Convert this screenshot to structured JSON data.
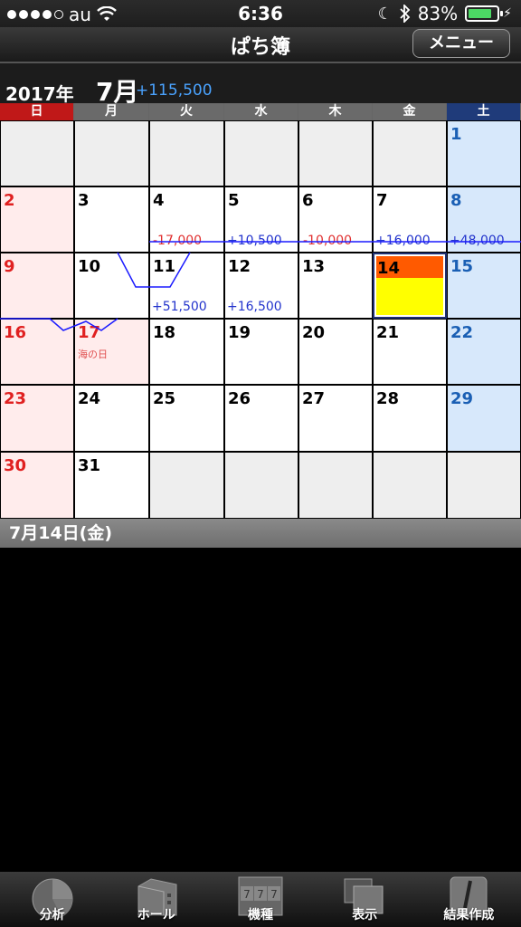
{
  "status_bar": {
    "carrier": "au",
    "time": "6:36",
    "battery": "83%",
    "battery_level": 0.83
  },
  "nav": {
    "title": "ぱち簿",
    "menu_label": "メニュー"
  },
  "header": {
    "year": "2017年",
    "month": "7月",
    "month_total": "+115,500"
  },
  "weekdays": [
    "日",
    "月",
    "火",
    "水",
    "木",
    "金",
    "土"
  ],
  "days": {
    "d1": "1",
    "d2": "2",
    "d3": "3",
    "d4": "4",
    "d5": "5",
    "d6": "6",
    "d7": "7",
    "d8": "8",
    "d9": "9",
    "d10": "10",
    "d11": "11",
    "d12": "12",
    "d13": "13",
    "d14": "14",
    "d15": "15",
    "d16": "16",
    "d17": "17",
    "d18": "18",
    "d19": "19",
    "d20": "20",
    "d21": "21",
    "d22": "22",
    "d23": "23",
    "d24": "24",
    "d25": "25",
    "d26": "26",
    "d27": "27",
    "d28": "28",
    "d29": "29",
    "d30": "30",
    "d31": "31"
  },
  "holiday_17": "海の日",
  "amounts": {
    "d4": "-17,000",
    "d5": "+10,500",
    "d6": "-10,000",
    "d7": "+16,000",
    "d8": "+48,000",
    "d11": "+51,500",
    "d12": "+16,500"
  },
  "selected_date": "7月14日(金)",
  "tabs": {
    "analysis": "分析",
    "hall": "ホール",
    "machine": "機種",
    "display": "表示",
    "result": "結果作成"
  },
  "colors": {
    "positive": "#2233cc",
    "negative": "#e03030",
    "sunday": "#e02020",
    "saturday": "#1a5fb4",
    "today_top": "#ff5a00",
    "today_bottom": "#ffff00"
  }
}
